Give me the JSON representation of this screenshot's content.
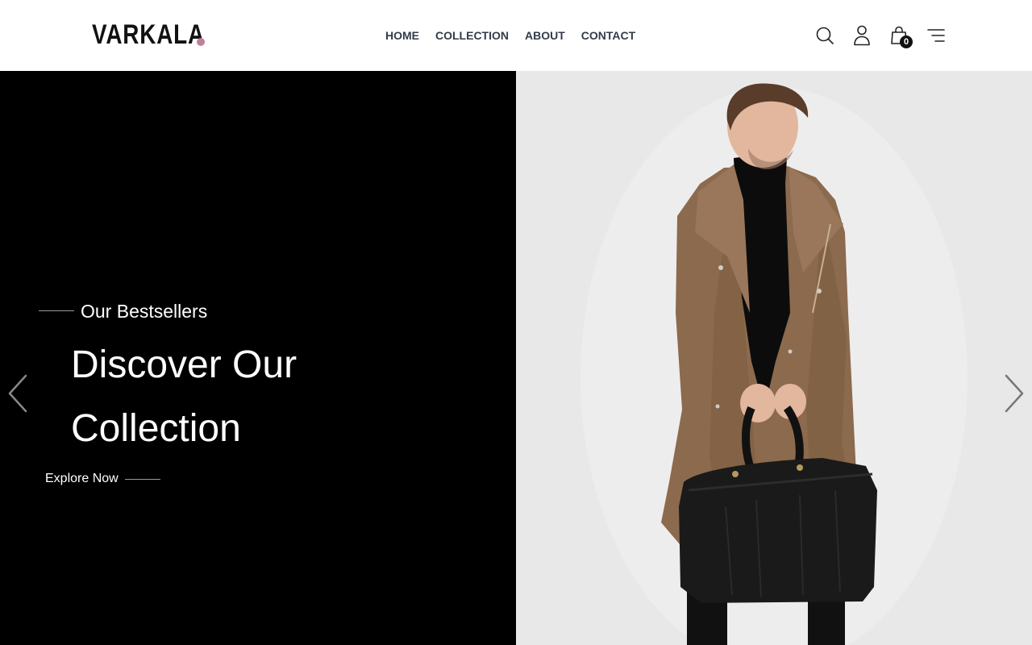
{
  "brand": {
    "name": "VARKALA",
    "dot_color": "#c07f9c"
  },
  "nav": {
    "items": [
      {
        "label": "HOME"
      },
      {
        "label": "COLLECTION"
      },
      {
        "label": "ABOUT"
      },
      {
        "label": "CONTACT"
      }
    ]
  },
  "header_icons": {
    "search": "search-icon",
    "account": "user-icon",
    "cart": "shopping-bag-icon",
    "cart_count": "0",
    "menu": "menu-icon"
  },
  "hero": {
    "subtitle": "Our Bestsellers",
    "title_line1": "Discover Our",
    "title_line2": "Collection",
    "cta_label": "Explore Now",
    "left_background": "#000000",
    "prev_icon": "chevron-left-icon",
    "next_icon": "chevron-right-icon"
  }
}
